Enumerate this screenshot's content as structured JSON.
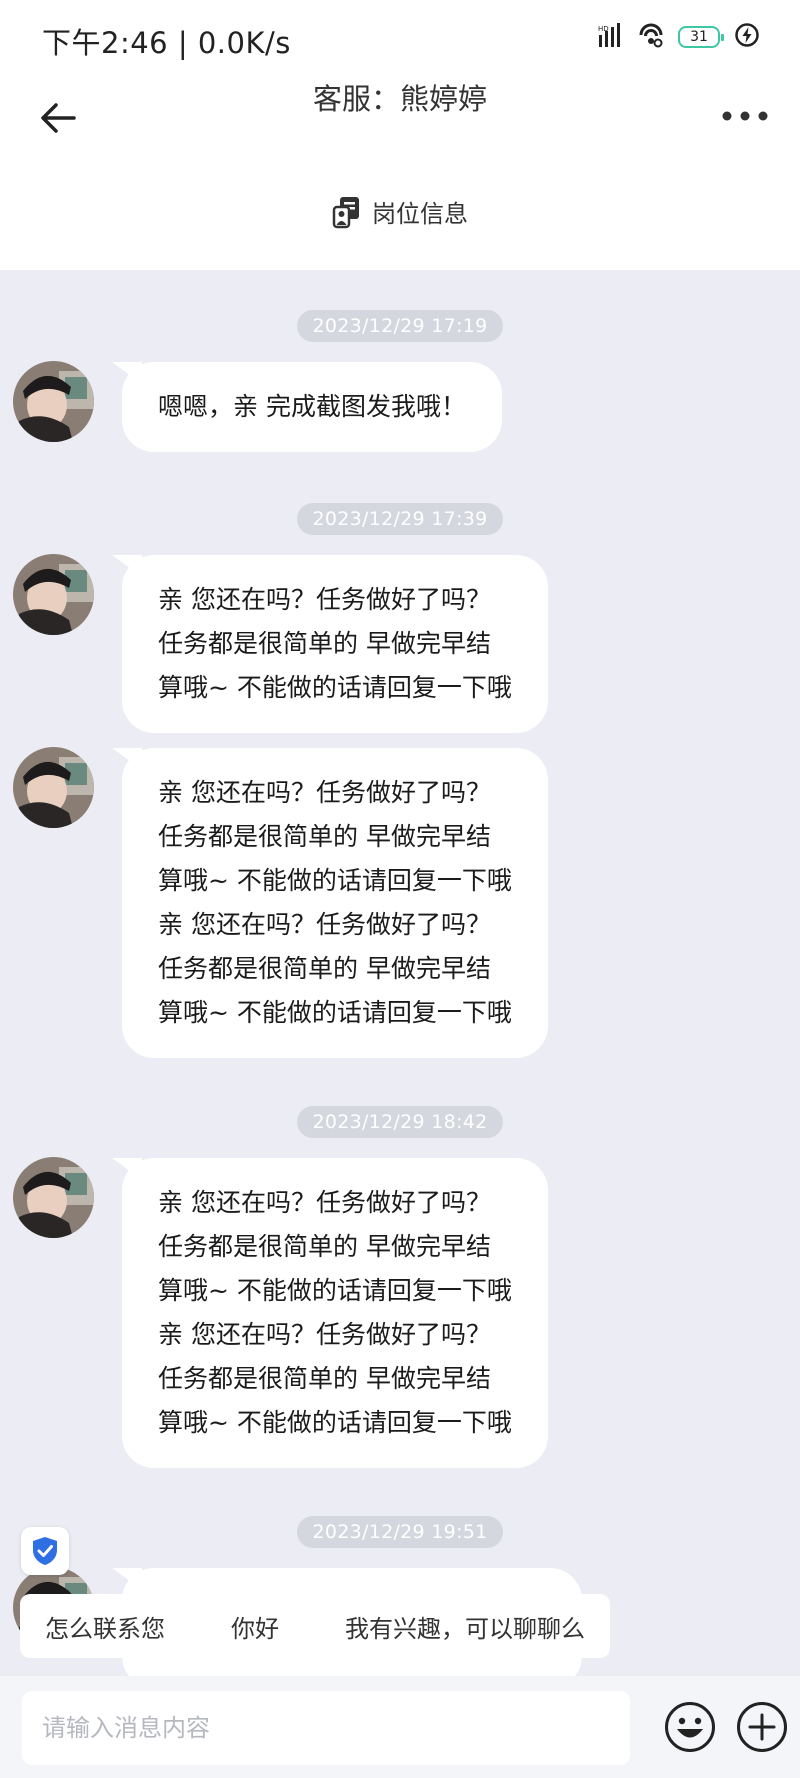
{
  "status_bar": {
    "time": "下午2:46 | 0.0K/s",
    "battery": "31"
  },
  "header": {
    "title": "客服：熊婷婷",
    "job_info_label": "岗位信息"
  },
  "messages": [
    {
      "timestamp": "2023/12/29 17:19",
      "text": "嗯嗯，亲 完成截图发我哦！"
    },
    {
      "timestamp": "2023/12/29 17:39",
      "text": "亲 您还在吗？任务做好了吗？\n任务都是很简单的 早做完早结\n算哦~ 不能做的话请回复一下哦"
    },
    {
      "text": "亲 您还在吗？任务做好了吗？\n任务都是很简单的 早做完早结\n算哦~ 不能做的话请回复一下哦\n亲 您还在吗？任务做好了吗？\n任务都是很简单的 早做完早结\n算哦~ 不能做的话请回复一下哦"
    },
    {
      "timestamp": "2023/12/29 18:42",
      "text": "亲 您还在吗？任务做好了吗？\n任务都是很简单的 早做完早结\n算哦~ 不能做的话请回复一下哦\n亲 您还在吗？任务做好了吗？\n任务都是很简单的 早做完早结\n算哦~ 不能做的话请回复一下哦"
    },
    {
      "timestamp": "2023/12/29 19:51",
      "text": ""
    }
  ],
  "quick_replies": [
    "怎么联系您",
    "你好",
    "我有兴趣，可以聊聊么"
  ],
  "input": {
    "placeholder": "请输入消息内容"
  },
  "icons": {
    "back": "arrow-left-icon",
    "more": "more-dots-icon",
    "job_info": "job-card-icon",
    "security": "shield-check-icon",
    "emoji": "smiley-icon",
    "plus": "plus-circle-icon"
  },
  "colors": {
    "chat_background": "#ebecf4",
    "timestamp_pill": "#d5d7de",
    "battery_accent": "#3fc7a4",
    "security_blue": "#2f6fe4"
  }
}
